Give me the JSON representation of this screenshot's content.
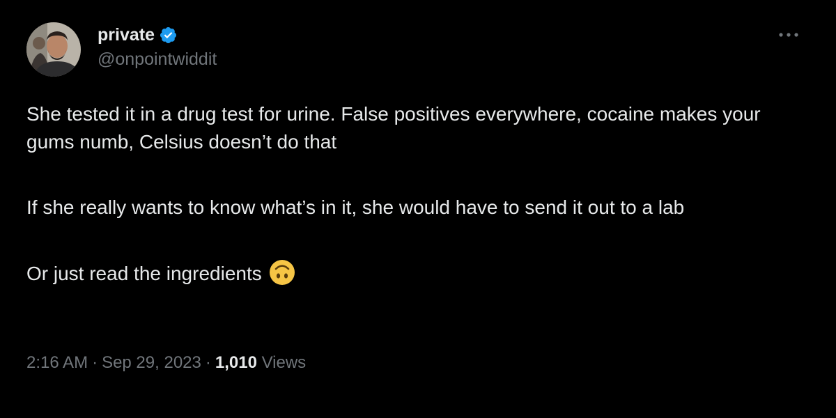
{
  "author": {
    "display_name": "private",
    "handle": "@onpointwiddit",
    "verified": true,
    "verified_icon": "verified-badge-icon",
    "avatar_icon": "profile-avatar"
  },
  "tweet": {
    "paragraphs": [
      "She tested it in a drug test for urine. False positives everywhere, cocaine makes your gums numb, Celsius doesn’t do that",
      "If she really wants to know what’s in it, she would have to send it out to a lab",
      "Or just read the ingredients"
    ],
    "trailing_emoji": "upside-down-face-icon"
  },
  "meta": {
    "time": "2:16 AM",
    "separator": "·",
    "date": "Sep 29, 2023",
    "views_count": "1,010",
    "views_label": "Views"
  },
  "more_icon": "more-horizontal-icon",
  "colors": {
    "background": "#000000",
    "primary_text": "#e7e9ea",
    "secondary_text": "#71767b",
    "verified_blue": "#1d9bf0",
    "emoji_yellow": "#f6c545"
  }
}
